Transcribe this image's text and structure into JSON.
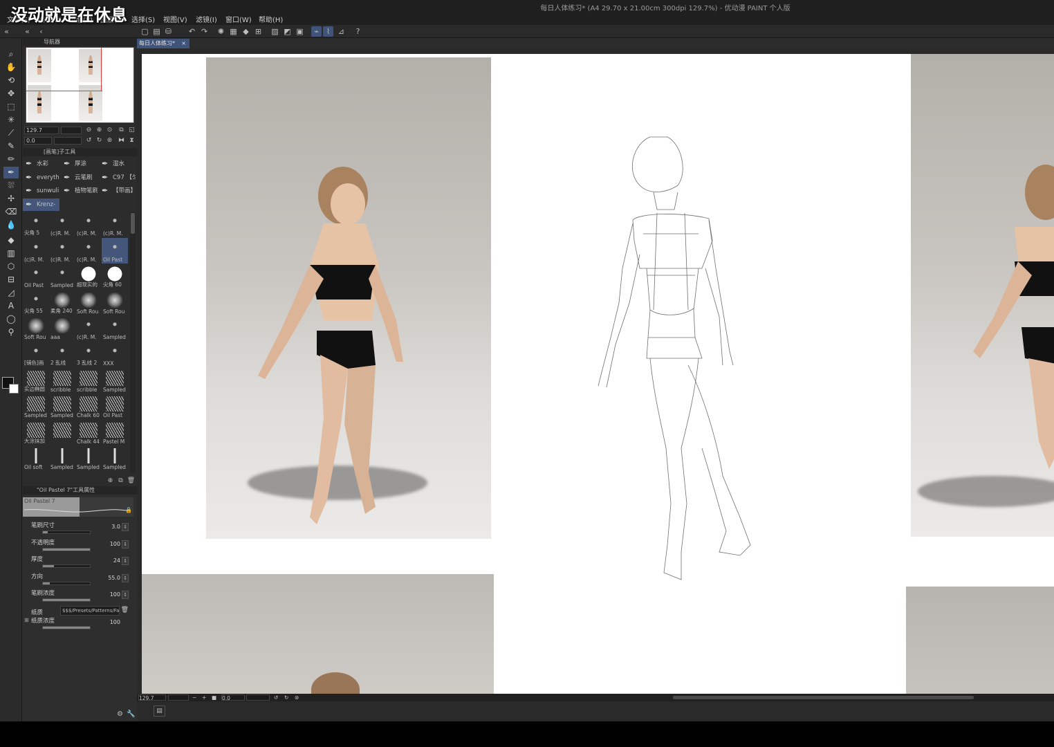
{
  "overlay_caption": "没动就是在休息",
  "window_title": "每日人体练习* (A4 29.70 x 21.00cm 300dpi 129.7%)  - 优动漫 PAINT 个人版",
  "menu": [
    "文件(F)",
    "编辑(E)",
    "页面(P)",
    "图层(L)",
    "选择(S)",
    "视图(V)",
    "滤镜(I)",
    "窗口(W)",
    "帮助(H)"
  ],
  "document_tab": "每日人体练习*",
  "navigator": {
    "title": "导航器",
    "zoom": "129.7",
    "rotation": "0.0"
  },
  "subtool_panel": {
    "title": "[画笔]子工具",
    "items": [
      "水彩",
      "厚涂",
      "湿水",
      "everyth",
      "云笔刷",
      "C97 【匀",
      "sunwuli",
      "植物笔刷",
      "【带画】",
      "Krenz-"
    ]
  },
  "brushes": [
    "尖角 5",
    "(c)R. M.",
    "(c)R. M.",
    "(c)R. M.",
    "(c)R. M.",
    "(c)R. M.",
    "(c)R. M.",
    "Oil Past",
    "Oil Past",
    "Sampled",
    "超现实的",
    "尖角 60",
    "尖角 55",
    "柔角 240",
    "Soft Rou",
    "Soft Rou",
    "Soft Rou",
    "aaa",
    "(c)R. M.",
    "Sampled",
    "[铺色]画",
    "2 乱线",
    "3 乱线 2",
    "XXX",
    "实边椭圆",
    "scribble",
    "scribble",
    "Sampled",
    "Sampled",
    "Sampled",
    "Chalk 60",
    "Oil Past",
    "大涂抹加",
    "",
    "Chalk 44",
    "Pastel M",
    "Oil soft",
    "Sampled",
    "Sampled",
    "Sampled"
  ],
  "tool_property": {
    "title": "\"Oil Pastel 7\"工具属性",
    "preset_name": "Oil Pastel 7",
    "rows": [
      {
        "label": "笔刷尺寸",
        "value": "3.0",
        "fill": 0.1
      },
      {
        "label": "不透明度",
        "value": "100",
        "fill": 1.0
      },
      {
        "label": "厚度",
        "value": "24",
        "fill": 0.24
      },
      {
        "label": "方向",
        "value": "55.0",
        "fill": 0.15
      },
      {
        "label": "笔刷浓度",
        "value": "100",
        "fill": 1.0
      }
    ],
    "paper_label": "纸质",
    "paper_path": "$$$/Presets/Patterns/Fa",
    "paper_density_label": "纸质浓度",
    "paper_density_value": "100"
  },
  "status": {
    "zoom": "129.7",
    "rotation": "0.0"
  }
}
